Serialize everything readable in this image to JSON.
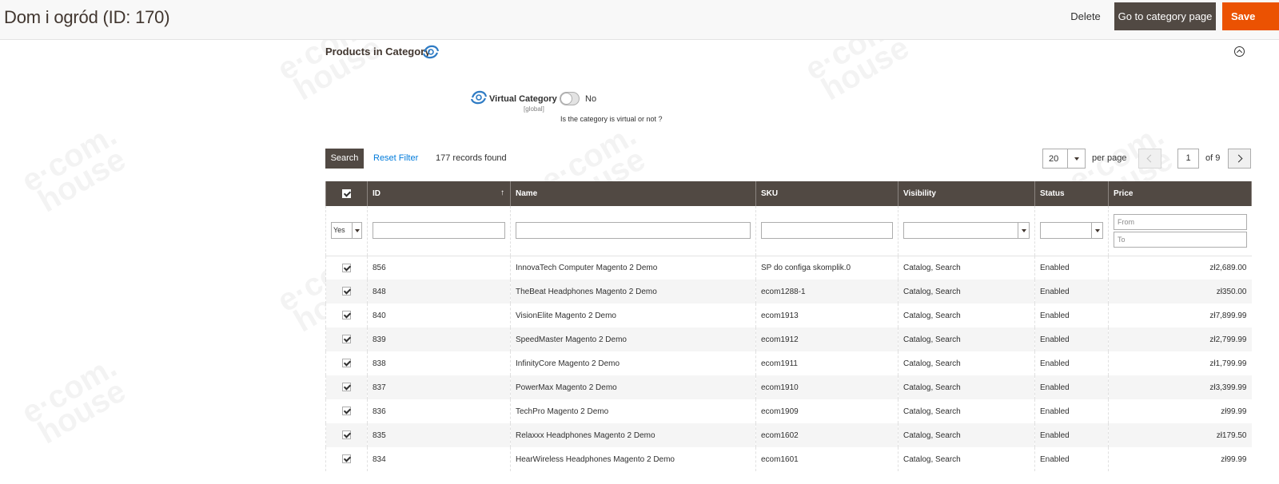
{
  "header": {
    "title": "Dom i ogród (ID: 170)",
    "delete_label": "Delete",
    "goto_label": "Go to category page",
    "save_label": "Save"
  },
  "section": {
    "title": "Products in Category"
  },
  "virtual_category": {
    "label": "Virtual Category",
    "scope": "[global]",
    "toggle_value": "No",
    "note": "Is the category is virtual or not ?"
  },
  "grid_actions": {
    "search_label": "Search",
    "reset_label": "Reset Filter",
    "records_text": "177 records found",
    "per_page_value": "20",
    "per_page_label": "per page",
    "page_current": "1",
    "page_of": "of 9"
  },
  "columns": [
    "ID",
    "Name",
    "SKU",
    "Visibility",
    "Status",
    "Price"
  ],
  "filters": {
    "in_category_value": "Yes",
    "price_from_placeholder": "From",
    "price_to_placeholder": "To"
  },
  "rows": [
    {
      "id": "856",
      "name": "InnovaTech Computer Magento 2 Demo",
      "sku": "SP do configa skomplik.0",
      "visibility": "Catalog, Search",
      "status": "Enabled",
      "price": "zł2,689.00"
    },
    {
      "id": "848",
      "name": "TheBeat Headphones Magento 2 Demo",
      "sku": "ecom1288-1",
      "visibility": "Catalog, Search",
      "status": "Enabled",
      "price": "zł350.00"
    },
    {
      "id": "840",
      "name": "VisionElite Magento 2 Demo",
      "sku": "ecom1913",
      "visibility": "Catalog, Search",
      "status": "Enabled",
      "price": "zł7,899.99"
    },
    {
      "id": "839",
      "name": "SpeedMaster Magento 2 Demo",
      "sku": "ecom1912",
      "visibility": "Catalog, Search",
      "status": "Enabled",
      "price": "zł2,799.99"
    },
    {
      "id": "838",
      "name": "InfinityCore Magento 2 Demo",
      "sku": "ecom1911",
      "visibility": "Catalog, Search",
      "status": "Enabled",
      "price": "zł1,799.99"
    },
    {
      "id": "837",
      "name": "PowerMax Magento 2 Demo",
      "sku": "ecom1910",
      "visibility": "Catalog, Search",
      "status": "Enabled",
      "price": "zł3,399.99"
    },
    {
      "id": "836",
      "name": "TechPro Magento 2 Demo",
      "sku": "ecom1909",
      "visibility": "Catalog, Search",
      "status": "Enabled",
      "price": "zł99.99"
    },
    {
      "id": "835",
      "name": "Relaxxx Headphones Magento 2 Demo",
      "sku": "ecom1602",
      "visibility": "Catalog, Search",
      "status": "Enabled",
      "price": "zł179.50"
    },
    {
      "id": "834",
      "name": "HearWireless Headphones Magento 2 Demo",
      "sku": "ecom1601",
      "visibility": "Catalog, Search",
      "status": "Enabled",
      "price": "zł99.99"
    }
  ],
  "watermark": "e·com. house",
  "colors": {
    "header_bg": "#514943",
    "accent_orange": "#eb5202",
    "link_blue": "#007bdb"
  }
}
